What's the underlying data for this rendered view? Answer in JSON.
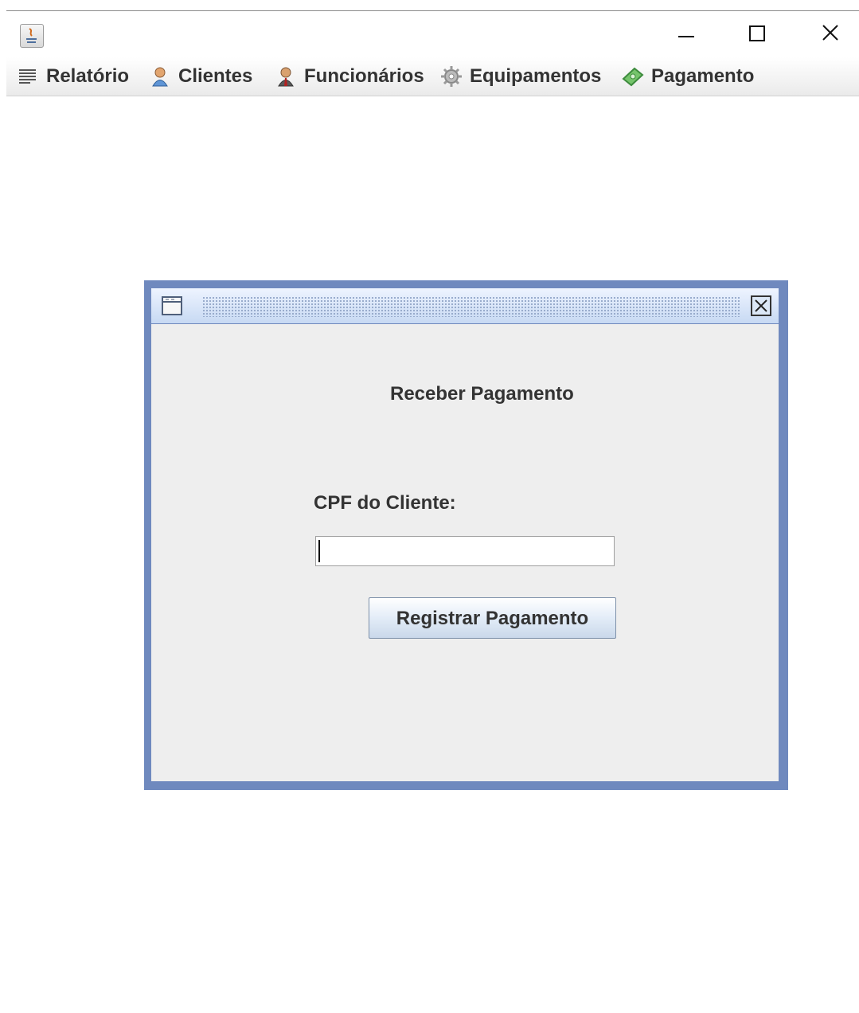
{
  "window": {
    "icons": {
      "app": "java-icon",
      "minimize": "minimize-icon",
      "maximize": "maximize-icon",
      "close": "close-icon"
    }
  },
  "menu": {
    "items": [
      {
        "label": "Relatório",
        "icon": "list-icon"
      },
      {
        "label": "Clientes",
        "icon": "client-icon"
      },
      {
        "label": "Funcionários",
        "icon": "employee-icon"
      },
      {
        "label": "Equipamentos",
        "icon": "gear-icon"
      },
      {
        "label": "Pagamento",
        "icon": "money-icon"
      }
    ]
  },
  "dialog": {
    "heading": "Receber Pagamento",
    "cpf_label": "CPF do Cliente:",
    "cpf_value": "",
    "button_label": "Registrar Pagamento",
    "icons": {
      "window": "window-icon",
      "close": "close-box-icon"
    }
  },
  "colors": {
    "dialog_border": "#6f89be",
    "dialog_background": "#eeeeee",
    "background_art": "#000000"
  }
}
